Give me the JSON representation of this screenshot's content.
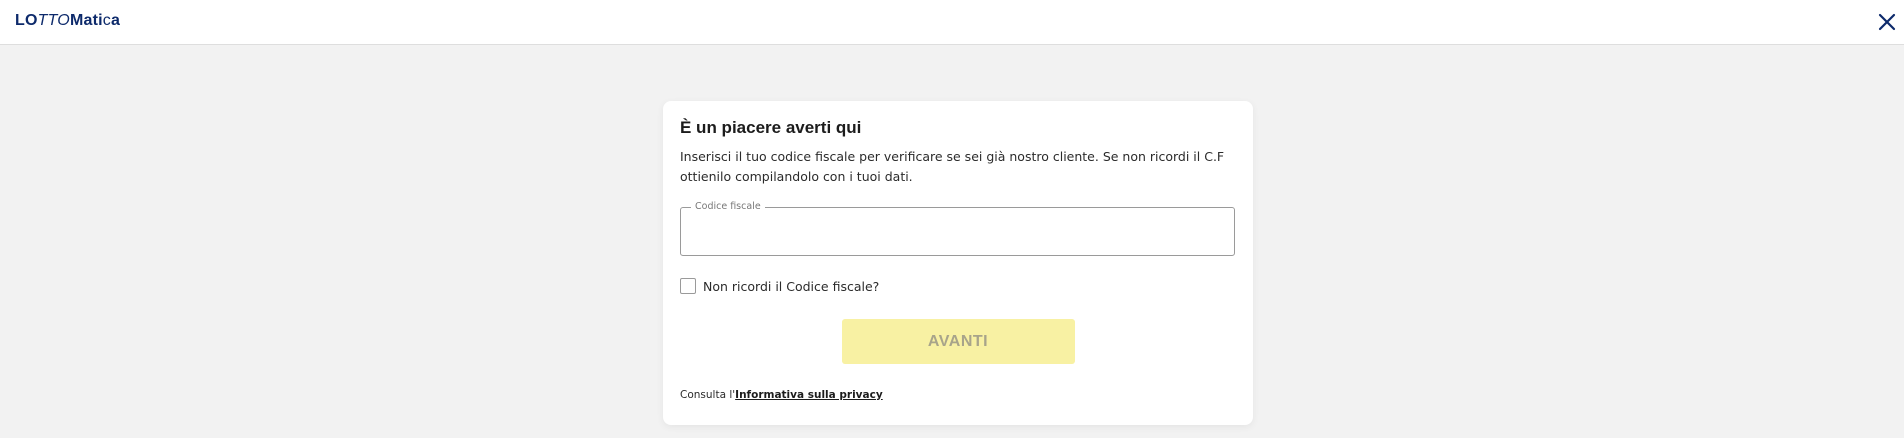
{
  "header": {
    "logo": {
      "part1": "LO",
      "part2": "TTO",
      "part3": "Mati",
      "part4": "c",
      "part5": "a"
    },
    "close_icon": "close-icon",
    "brand_color": "#0d2a6b"
  },
  "card": {
    "title": "È un piacere averti qui",
    "description": "Inserisci il tuo codice fiscale per verificare se sei già nostro cliente. Se non ricordi il C.F ottienilo compilandolo con i tuoi dati.",
    "fiscal_code_field": {
      "label": "Codice fiscale",
      "value": ""
    },
    "forgot_checkbox": {
      "label": "Non ricordi il Codice fiscale?",
      "checked": false
    },
    "next_button": {
      "label": "AVANTI",
      "enabled": false,
      "color": "#f8f1a3"
    },
    "privacy": {
      "prefix": "Consulta l'",
      "link_text": "Informativa sulla privacy"
    }
  }
}
